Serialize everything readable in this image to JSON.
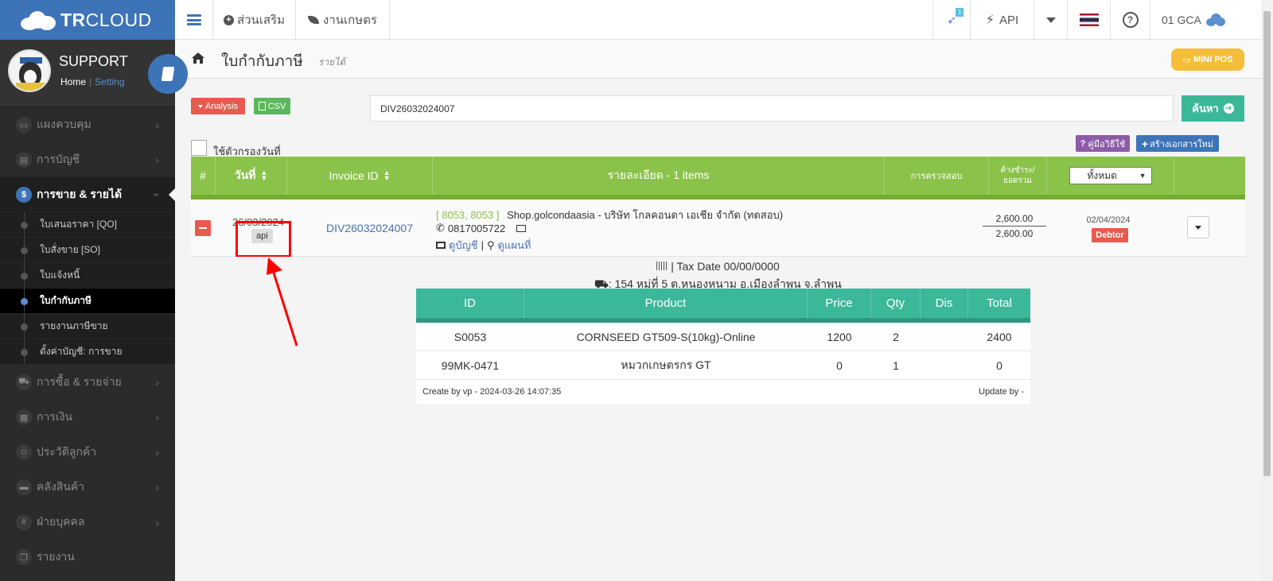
{
  "topbar": {
    "brand_bold": "TR",
    "brand_rest": "CLOUD",
    "addons_label": "ส่วนเสริม",
    "agri_label": "งานเกษตร",
    "notif_count": "1",
    "api_label": "API",
    "company_label": "01 GCA"
  },
  "profile": {
    "name": "SUPPORT",
    "home_link": "Home",
    "setting_link": "Setting"
  },
  "sidebar": {
    "items": [
      {
        "label": "แผงควบคุม",
        "icon": "monitor-icon"
      },
      {
        "label": "การบัญชี",
        "icon": "book-icon"
      },
      {
        "label": "การขาย & รายได้",
        "icon": "dollar-icon"
      },
      {
        "label": "การซื้อ & รายจ่าย",
        "icon": "cart-icon"
      },
      {
        "label": "การเงิน",
        "icon": "calendar-icon"
      },
      {
        "label": "ประวัติลูกค้า",
        "icon": "users-icon"
      },
      {
        "label": "คลังสินค้า",
        "icon": "truck-icon"
      },
      {
        "label": "ฝ่ายบุคคล",
        "icon": "hash-icon"
      },
      {
        "label": "รายงาน",
        "icon": "copy-icon"
      }
    ],
    "sub_items": [
      {
        "label": "ใบเสนอราคา [QO]"
      },
      {
        "label": "ใบสั่งขาย [SO]"
      },
      {
        "label": "ใบแจ้งหนี้"
      },
      {
        "label": "ใบกำกับภาษี"
      },
      {
        "label": "รายงานภาษีขาย"
      },
      {
        "label": "ตั้งค่าบัญชี: การขาย"
      }
    ]
  },
  "page": {
    "title": "ใบกำกับภาษี",
    "subtitle": "รายได้",
    "minipos_label": "MINI POS"
  },
  "toolbar": {
    "analysis_label": "Analysis",
    "csv_label": "CSV",
    "search_value": "DIV26032024007",
    "search_button": "ค้นหา",
    "date_filter_label": "ใช้ตัวกรองวันที่",
    "manual_button": "คู่มือวิธีใช้",
    "create_button": "สร้างเอกสารใหม่"
  },
  "table": {
    "headers": {
      "num": "#",
      "date": "วันที่",
      "invoice": "Invoice ID",
      "detail": "รายละเอียด - 1 items",
      "check": "การตรวจสอบ",
      "outstanding": "ค้างชำระ/ยอดรวม",
      "status_filter": "ทั้งหมด"
    },
    "row": {
      "date": "26/03/2024",
      "source_badge": "api",
      "invoice_id": "DIV26032024007",
      "codes": "[ 8053, 8053 ]",
      "shop": "Shop.golcondaasia -",
      "company": "บริษัท โกลคอนดา เอเชีย จำกัด (ทดสอบ)",
      "phone": "0817005722",
      "view_account": "ดูบัญชี",
      "view_map": "ดูแผนที่",
      "outstanding": "2,600.00",
      "total": "2,600.00",
      "due_date": "02/04/2024",
      "status": "Debtor"
    }
  },
  "detail": {
    "tax_date": "| Tax Date 00/00/0000",
    "address": ": 154 หมู่ที่ 5 ต.หนองหนาม อ.เมืองลำพูน จ.ลำพูน",
    "columns": [
      "ID",
      "Product",
      "Price",
      "Qty",
      "Dis",
      "Total"
    ],
    "items": [
      {
        "id": "S0053",
        "product": "CORNSEED GT509-S(10kg)-Online",
        "price": "1200",
        "qty": "2",
        "dis": "",
        "total": "2400"
      },
      {
        "id": "99MK-0471",
        "product": "หมวกเกษตรกร GT",
        "price": "0",
        "qty": "1",
        "dis": "",
        "total": "0"
      }
    ],
    "created": "Create by vp - 2024-03-26 14:07:35",
    "updated": "Update by -"
  },
  "colors": {
    "brand_blue": "#3d74b8",
    "table_green": "#8bc34a",
    "item_teal": "#3bb89a",
    "danger_red": "#e95a4e",
    "minipos_yellow": "#f5bd3a",
    "annotation_red": "#ff0000"
  }
}
